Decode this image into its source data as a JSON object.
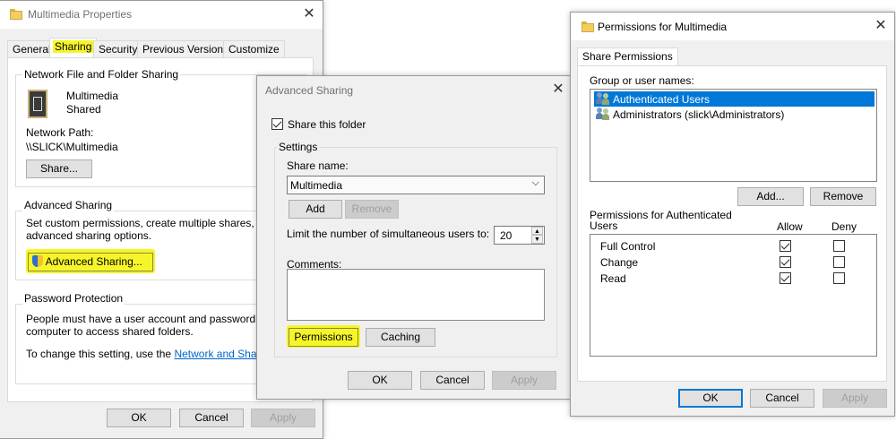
{
  "props": {
    "title": "Multimedia Properties",
    "tabs": [
      "General",
      "Sharing",
      "Security",
      "Previous Versions",
      "Customize"
    ],
    "nffs_group": "Network File and Folder Sharing",
    "folder_name": "Multimedia",
    "folder_status": "Shared",
    "network_path_label": "Network Path:",
    "network_path": "\\\\SLICK\\Multimedia",
    "share_button": "Share...",
    "adv_group": "Advanced Sharing",
    "adv_desc_1": "Set custom permissions, create multiple shares, and set",
    "adv_desc_2": "advanced sharing options.",
    "adv_button": "Advanced Sharing...",
    "pw_group": "Password Protection",
    "pw_desc_1": "People must have a user account and password for this",
    "pw_desc_2": "computer to access shared folders.",
    "pw_change": "To change this setting, use the",
    "pw_link": "Network and Sharing C",
    "ok": "OK",
    "cancel": "Cancel",
    "apply": "Apply"
  },
  "adv": {
    "title": "Advanced Sharing",
    "share_checkbox": "Share this folder",
    "settings_group": "Settings",
    "share_name_label": "Share name:",
    "share_name_value": "Multimedia",
    "add": "Add",
    "remove": "Remove",
    "limit_label": "Limit the number of simultaneous users to:",
    "limit_value": "20",
    "comments_label": "Comments:",
    "permissions": "Permissions",
    "caching": "Caching",
    "ok": "OK",
    "cancel": "Cancel",
    "apply": "Apply"
  },
  "perm": {
    "title": "Permissions for Multimedia",
    "tab": "Share Permissions",
    "group_label": "Group or user names:",
    "users": [
      "Authenticated Users",
      "Administrators (slick\\Administrators)"
    ],
    "add": "Add...",
    "remove": "Remove",
    "perms_for_1": "Permissions for Authenticated",
    "perms_for_2": "Users",
    "allow": "Allow",
    "deny": "Deny",
    "rows": [
      {
        "name": "Full Control",
        "allow": true,
        "deny": false
      },
      {
        "name": "Change",
        "allow": true,
        "deny": false
      },
      {
        "name": "Read",
        "allow": true,
        "deny": false
      }
    ],
    "ok": "OK",
    "cancel": "Cancel",
    "apply": "Apply"
  },
  "colors": {
    "highlight": "#f6f52a",
    "selection": "#0078d7",
    "link": "#0066cc"
  }
}
